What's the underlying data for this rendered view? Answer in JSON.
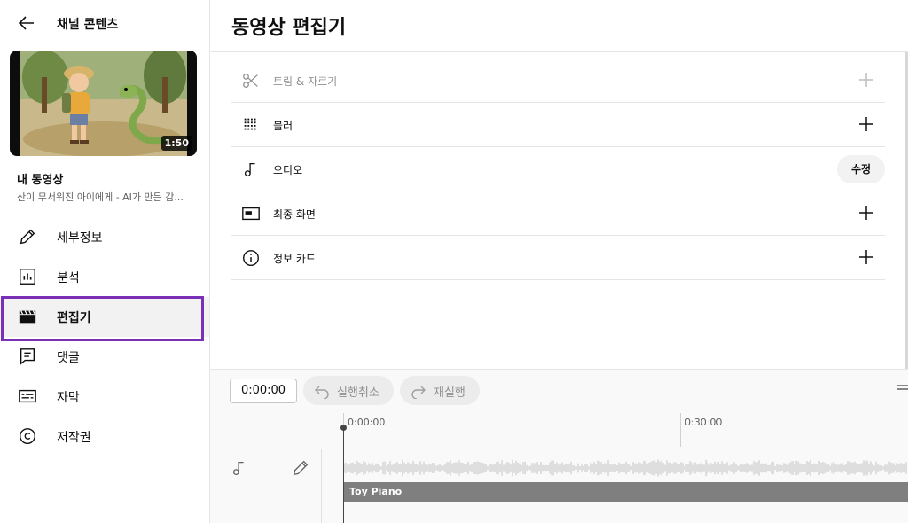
{
  "sidebar": {
    "back_title": "채널 콘텐츠",
    "thumbnail_duration": "1:50",
    "video_heading": "내 동영상",
    "video_subtitle": "산이 무서워진 아이에게 - AI가 만든 감...",
    "nav": [
      {
        "label": "세부정보",
        "icon": "pencil-icon"
      },
      {
        "label": "분석",
        "icon": "analytics-icon"
      },
      {
        "label": "편집기",
        "icon": "clapperboard-icon"
      },
      {
        "label": "댓글",
        "icon": "comment-icon"
      },
      {
        "label": "자막",
        "icon": "subtitles-icon"
      },
      {
        "label": "저작권",
        "icon": "copyright-icon"
      }
    ],
    "active_index": 2,
    "highlight_color": "#7b2fb5"
  },
  "main": {
    "title": "동영상 편집기",
    "tools": [
      {
        "label": "트림 & 자르기",
        "icon": "scissors-icon",
        "action": "plus",
        "disabled": true
      },
      {
        "label": "블러",
        "icon": "blur-icon",
        "action": "plus",
        "disabled": false
      },
      {
        "label": "오디오",
        "icon": "music-note-icon",
        "action": "edit",
        "action_label": "수정",
        "disabled": false
      },
      {
        "label": "최종 화면",
        "icon": "end-screen-icon",
        "action": "plus",
        "disabled": false
      },
      {
        "label": "정보 카드",
        "icon": "info-icon",
        "action": "plus",
        "disabled": false
      }
    ]
  },
  "timeline": {
    "current_time": "0:00:00",
    "undo_label": "실행취소",
    "redo_label": "재실행",
    "ticks": [
      "0:00:00",
      "0:30:00"
    ],
    "audio_track_label": "Toy Piano"
  }
}
